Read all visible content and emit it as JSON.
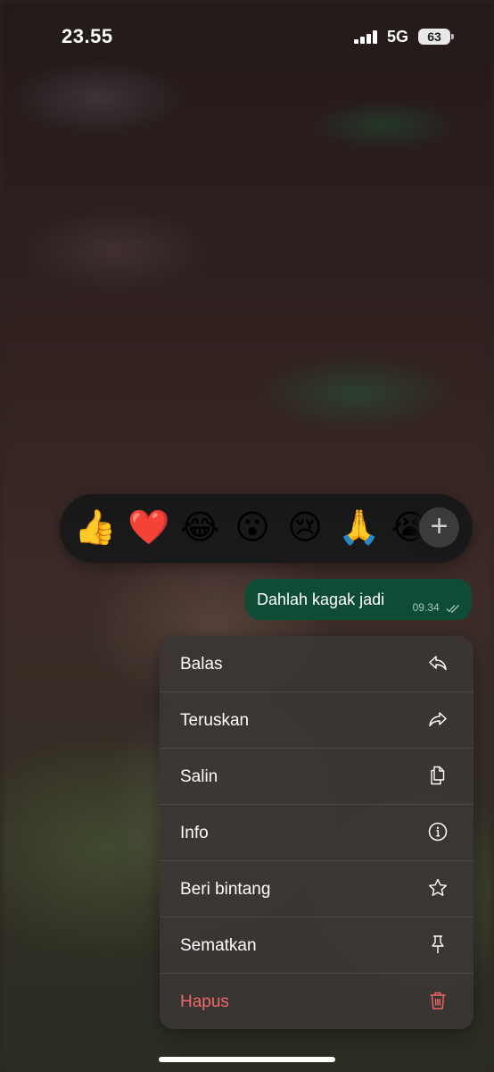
{
  "status_bar": {
    "time": "23.55",
    "network": "5G",
    "battery": "63"
  },
  "reactions": {
    "emojis": [
      {
        "glyph": "👍",
        "name": "thumbs-up"
      },
      {
        "glyph": "❤️",
        "name": "red-heart"
      },
      {
        "glyph": "😂",
        "name": "tears-of-joy"
      },
      {
        "glyph": "😮",
        "name": "surprised"
      },
      {
        "glyph": "😢",
        "name": "crying"
      },
      {
        "glyph": "🙏",
        "name": "folded-hands"
      },
      {
        "glyph": "😭",
        "name": "loudly-crying"
      }
    ],
    "more_icon": "plus-icon",
    "more_glyph": "+"
  },
  "message": {
    "text": "Dahlah kagak jadi",
    "time": "09.34",
    "read_icon": "double-check-icon"
  },
  "menu": {
    "items": [
      {
        "label": "Balas",
        "icon": "reply-icon"
      },
      {
        "label": "Teruskan",
        "icon": "forward-icon"
      },
      {
        "label": "Salin",
        "icon": "copy-icon"
      },
      {
        "label": "Info",
        "icon": "info-icon"
      },
      {
        "label": "Beri bintang",
        "icon": "star-icon"
      },
      {
        "label": "Sematkan",
        "icon": "pin-icon"
      },
      {
        "label": "Hapus",
        "icon": "trash-icon"
      }
    ]
  },
  "colors": {
    "bubble": "#0f4c37",
    "menu_bg": "#3a3634",
    "danger": "#f0676b",
    "reaction_bar": "#161818"
  }
}
